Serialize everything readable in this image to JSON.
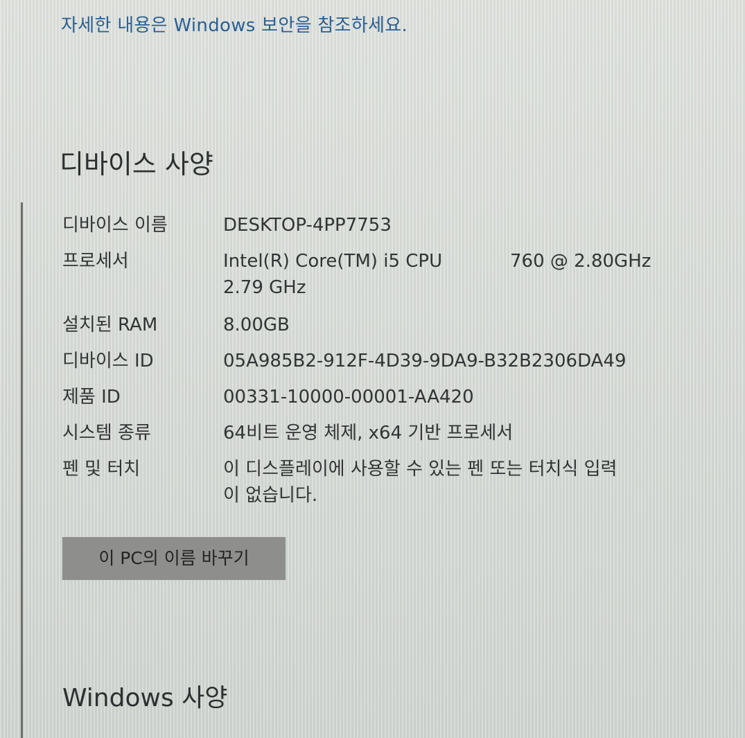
{
  "security_link": {
    "text": "자세한 내용은 Windows 보안을 참조하세요."
  },
  "device_specs": {
    "title": "디바이스 사양",
    "rows": [
      {
        "label": "디바이스 이름",
        "value": "DESKTOP-4PP7753"
      },
      {
        "label": "프로세서",
        "value_line1": "Intel(R) Core(TM) i5 CPU",
        "value_line1_freq": "760  @ 2.80GHz",
        "value_line2": "2.79 GHz"
      },
      {
        "label": "설치된 RAM",
        "value": "8.00GB"
      },
      {
        "label": "디바이스 ID",
        "value": "05A985B2-912F-4D39-9DA9-B32B2306DA49"
      },
      {
        "label": "제품 ID",
        "value": "00331-10000-00001-AA420"
      },
      {
        "label": "시스템 종류",
        "value": "64비트 운영 체제, x64 기반 프로세서"
      },
      {
        "label": "펜 및 터치",
        "value_line1": "이 디스플레이에 사용할 수 있는 펜 또는 터치식 입력",
        "value_line2": "이 없습니다."
      }
    ],
    "rename_button": "이 PC의 이름 바꾸기"
  },
  "windows_specs": {
    "title": "Windows 사양"
  }
}
